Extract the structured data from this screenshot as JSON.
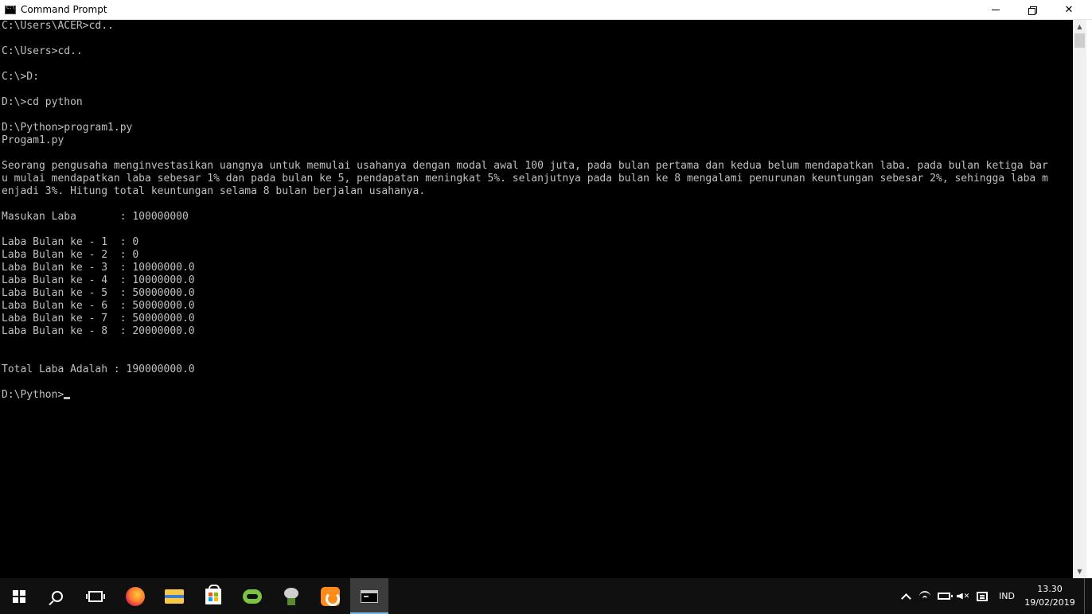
{
  "window": {
    "title": "Command Prompt",
    "minimize": "minimize",
    "maximize": "maximize",
    "close": "close"
  },
  "console": {
    "lines": [
      "C:\\Users\\ACER>cd..",
      "",
      "C:\\Users>cd..",
      "",
      "C:\\>D:",
      "",
      "D:\\>cd python",
      "",
      "D:\\Python>program1.py",
      "Progam1.py",
      "",
      "Seorang pengusaha menginvestasikan uangnya untuk memulai usahanya dengan modal awal 100 juta, pada bulan pertama dan kedua belum mendapatkan laba. pada bulan ketiga bar",
      "u mulai mendapatkan laba sebesar 1% dan pada bulan ke 5, pendapatan meningkat 5%. selanjutnya pada bulan ke 8 mengalami penurunan keuntungan sebesar 2%, sehingga laba m",
      "enjadi 3%. Hitung total keuntungan selama 8 bulan berjalan usahanya.",
      "",
      "Masukan Laba       : 100000000",
      "",
      "Laba Bulan ke - 1  : 0",
      "Laba Bulan ke - 2  : 0",
      "Laba Bulan ke - 3  : 10000000.0",
      "Laba Bulan ke - 4  : 10000000.0",
      "Laba Bulan ke - 5  : 50000000.0",
      "Laba Bulan ke - 6  : 50000000.0",
      "Laba Bulan ke - 7  : 50000000.0",
      "Laba Bulan ke - 8  : 20000000.0",
      "",
      "",
      "Total Laba Adalah : 190000000.0",
      ""
    ],
    "prompt": "D:\\Python>"
  },
  "taskbar": {
    "apps": [
      {
        "name": "start",
        "icon": "windows-logo-icon"
      },
      {
        "name": "search",
        "icon": "search-icon"
      },
      {
        "name": "task-view",
        "icon": "task-view-icon"
      },
      {
        "name": "firefox",
        "icon": "firefox-icon"
      },
      {
        "name": "file-explorer",
        "icon": "folder-icon"
      },
      {
        "name": "store",
        "icon": "store-icon"
      },
      {
        "name": "wechat",
        "icon": "wechat-icon"
      },
      {
        "name": "bonsai",
        "icon": "bonsai-icon"
      },
      {
        "name": "uc-browser",
        "icon": "uc-browser-icon"
      },
      {
        "name": "command-prompt",
        "icon": "cmd-icon",
        "active": true
      }
    ],
    "tray": {
      "language": "IND",
      "time": "13.30",
      "date": "19/02/2019"
    }
  },
  "colors": {
    "console_bg": "#000000",
    "console_fg": "#c0c0c0",
    "taskbar_bg": "#101010",
    "active_app_underline": "#76b9ed"
  }
}
